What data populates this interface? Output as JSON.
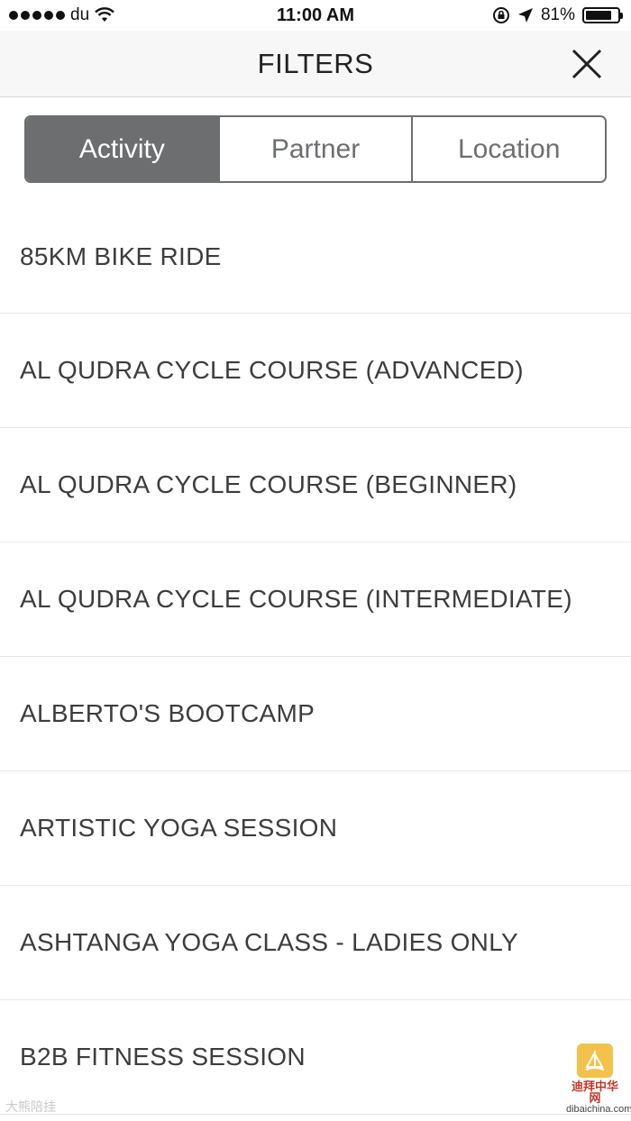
{
  "status_bar": {
    "carrier": "du",
    "time": "11:00 AM",
    "battery_percent": "81%",
    "battery_level": 0.81
  },
  "header": {
    "title": "FILTERS",
    "close_icon": "close-icon"
  },
  "tabs": [
    {
      "label": "Activity",
      "active": true
    },
    {
      "label": "Partner",
      "active": false
    },
    {
      "label": "Location",
      "active": false
    }
  ],
  "activities": [
    "85KM BIKE RIDE",
    "AL QUDRA CYCLE COURSE (ADVANCED)",
    "AL QUDRA CYCLE COURSE (BEGINNER)",
    "AL QUDRA CYCLE COURSE (INTERMEDIATE)",
    "ALBERTO'S BOOTCAMP",
    "ARTISTIC YOGA SESSION",
    "ASHTANGA YOGA CLASS - LADIES ONLY",
    "B2B FITNESS SESSION"
  ],
  "watermark": {
    "left_text": "大熊陪挂",
    "right_cn": "迪拜中华网",
    "right_url": "dibaichina.com"
  },
  "colors": {
    "segment_active": "#6d6e70",
    "header_bg": "#f7f7f7"
  }
}
